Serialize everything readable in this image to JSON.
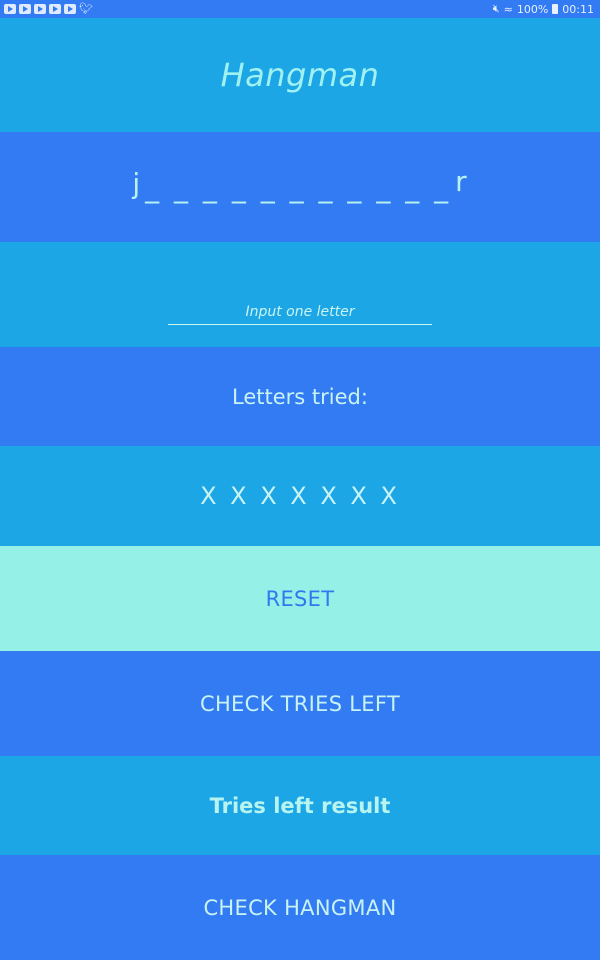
{
  "status_bar": {
    "battery": "100%",
    "time": "00:11"
  },
  "app": {
    "title": "Hangman"
  },
  "word": {
    "first_letter": "j",
    "blanks": "_ _ _ _ _ _ _ _ _ _ _",
    "last_letter": "r"
  },
  "guess_input": {
    "placeholder": "Input one letter",
    "value": ""
  },
  "letters_tried": {
    "label": "Letters tried:",
    "value": "X X X X X X X"
  },
  "buttons": {
    "reset": "RESET",
    "check_tries": "CHECK TRIES LEFT",
    "check_hangman": "CHECK HANGMAN"
  },
  "tries_result": {
    "text": "Tries left result"
  },
  "colors": {
    "blue_band": "#337bf2",
    "cyan_band": "#1da6e6",
    "mint_button": "#95f1e8"
  },
  "icons": [
    "youtube-icon",
    "twitter-icon",
    "mute-icon",
    "wifi-icon",
    "battery-icon"
  ]
}
